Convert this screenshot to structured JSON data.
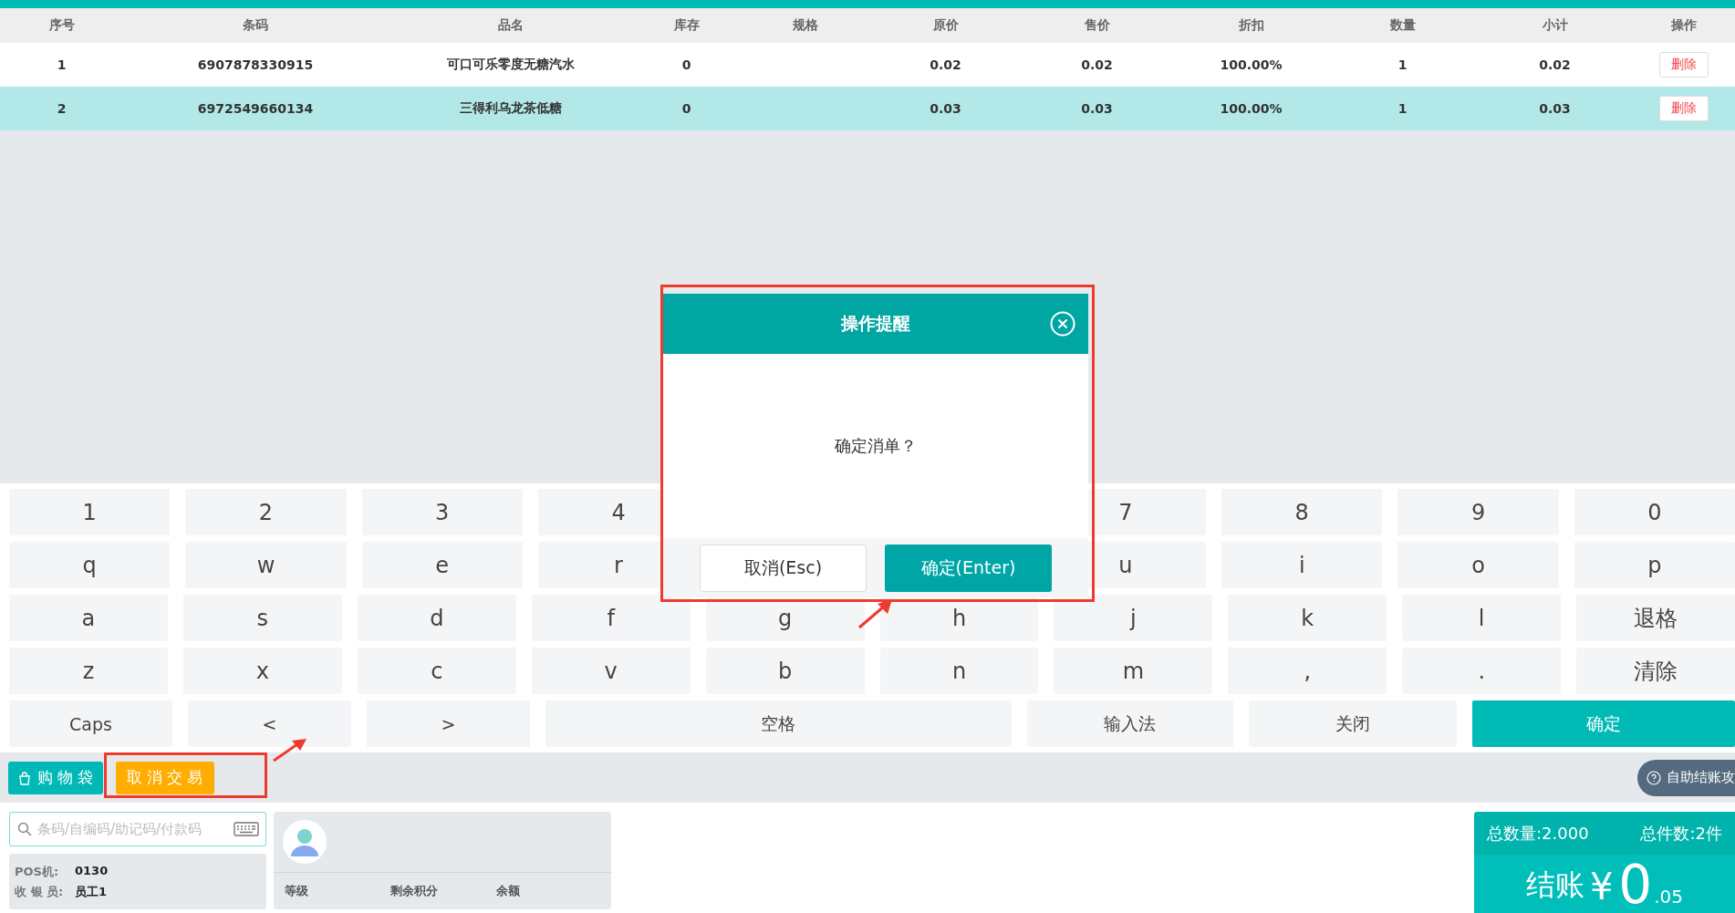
{
  "table": {
    "columns": [
      "序号",
      "条码",
      "品名",
      "库存",
      "规格",
      "原价",
      "售价",
      "折扣",
      "数量",
      "小计",
      "操作"
    ],
    "rows": [
      {
        "cells": [
          "1",
          "6907878330915",
          "可口可乐零度无糖汽水",
          "0",
          "",
          "0.02",
          "0.02",
          "100.00%",
          "1",
          "0.02"
        ],
        "action": "删除",
        "selected": false
      },
      {
        "cells": [
          "2",
          "6972549660134",
          "三得利乌龙茶低糖",
          "0",
          "",
          "0.03",
          "0.03",
          "100.00%",
          "1",
          "0.03"
        ],
        "action": "删除",
        "selected": true
      }
    ]
  },
  "keyboard": {
    "rows": [
      [
        "1",
        "2",
        "3",
        "4",
        null,
        null,
        "7",
        "8",
        "9",
        "0"
      ],
      [
        "q",
        "w",
        "e",
        "r",
        null,
        null,
        "u",
        "i",
        "o",
        "p"
      ],
      [
        "a",
        "s",
        "d",
        "f",
        "g",
        "h",
        "j",
        "k",
        "l",
        "退格"
      ],
      [
        "z",
        "x",
        "c",
        "v",
        "b",
        "n",
        "m",
        ",",
        ".",
        "清除"
      ]
    ],
    "bottom_row": [
      "Caps",
      "<",
      ">",
      "空格",
      "输入法",
      "关闭"
    ],
    "confirm_key": "确定"
  },
  "dialog": {
    "title": "操作提醒",
    "message": "确定消单？",
    "buttons": [
      {
        "label": "取消(Esc)",
        "kind": "secondary"
      },
      {
        "label": "确定(Enter)",
        "kind": "primary"
      }
    ]
  },
  "toolbar": {
    "buttons": [
      {
        "label": "购物袋",
        "kind": "bag"
      },
      {
        "label": "取消交易",
        "kind": "cancel"
      }
    ],
    "help_pill": "自助结账攻"
  },
  "search": {
    "placeholder": "条码/自编码/助记码/付款码"
  },
  "terminal": [
    {
      "label": "POS机:",
      "value": "0130"
    },
    {
      "label": "收 银 员:",
      "value": "员工1"
    }
  ],
  "member": {
    "fields": [
      "等级",
      "剩余积分",
      "余额"
    ]
  },
  "summary": {
    "total_qty": "总数量:2.000",
    "total_items": "总件数:2件",
    "checkout_label": "结账",
    "currency": "¥",
    "amount_integer": "0",
    "amount_decimal": ".05"
  }
}
